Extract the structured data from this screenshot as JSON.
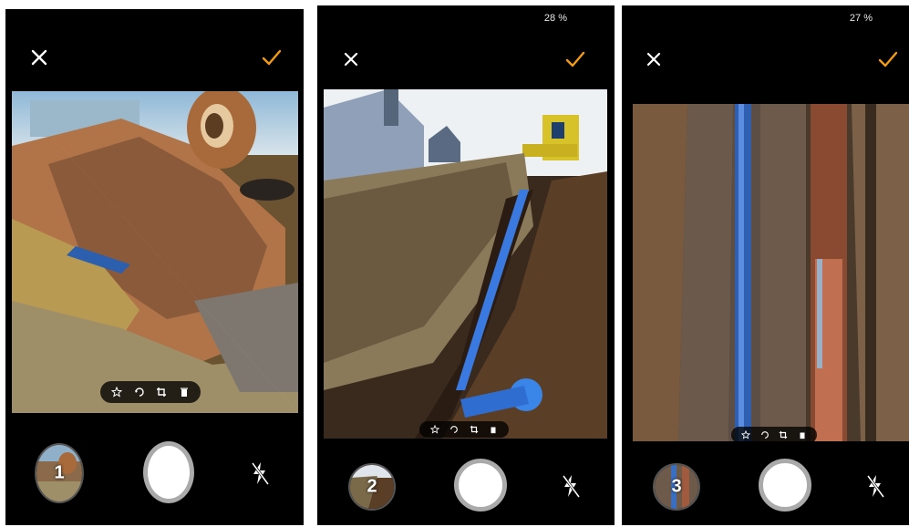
{
  "screens": [
    {
      "thumbnail_number": "1",
      "battery": ""
    },
    {
      "thumbnail_number": "2",
      "battery": "28 %"
    },
    {
      "thumbnail_number": "3",
      "battery": "27 %"
    }
  ],
  "icons": {
    "close": "close-icon",
    "confirm": "check-icon",
    "edit_tools": [
      "star-icon",
      "rotate-icon",
      "crop-icon",
      "delete-icon"
    ],
    "flash": "flash-off-icon"
  },
  "colors": {
    "accent": "#f39c12",
    "background": "#000000",
    "shutter": "#ffffff"
  }
}
